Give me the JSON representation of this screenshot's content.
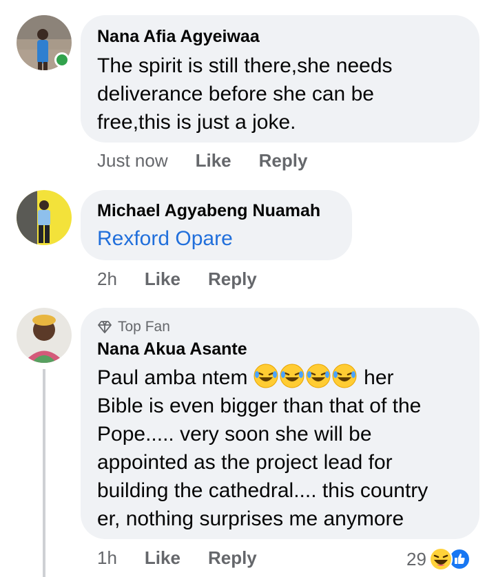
{
  "comments": [
    {
      "author": "Nana Afia Agyeiwaa",
      "text_lines": [
        "The spirit is still there,she needs",
        "deliverance before she can be",
        "free,this is just a joke."
      ],
      "time": "Just now",
      "like": "Like",
      "reply": "Reply"
    },
    {
      "author": "Michael Agyabeng Nuamah",
      "tag": "Rexford Opare",
      "time": "2h",
      "like": "Like",
      "reply": "Reply"
    },
    {
      "badge": "Top Fan",
      "author": "Nana Akua Asante",
      "text_first": "Paul amba ntem",
      "text_after_emoji": " her",
      "text_lines": [
        "Bible is even bigger than that of the",
        "Pope..... very soon she will be",
        "appointed as the project lead for",
        "building the cathedral.... this country",
        "er, nothing surprises me anymore"
      ],
      "emoji_name": "rolling-on-floor-laughing",
      "time": "1h",
      "like": "Like",
      "reply": "Reply",
      "reaction_count": "29"
    }
  ],
  "colors": {
    "bubble": "#f0f2f5",
    "link": "#216fdb",
    "meta": "#65676b",
    "online": "#31a24c"
  }
}
